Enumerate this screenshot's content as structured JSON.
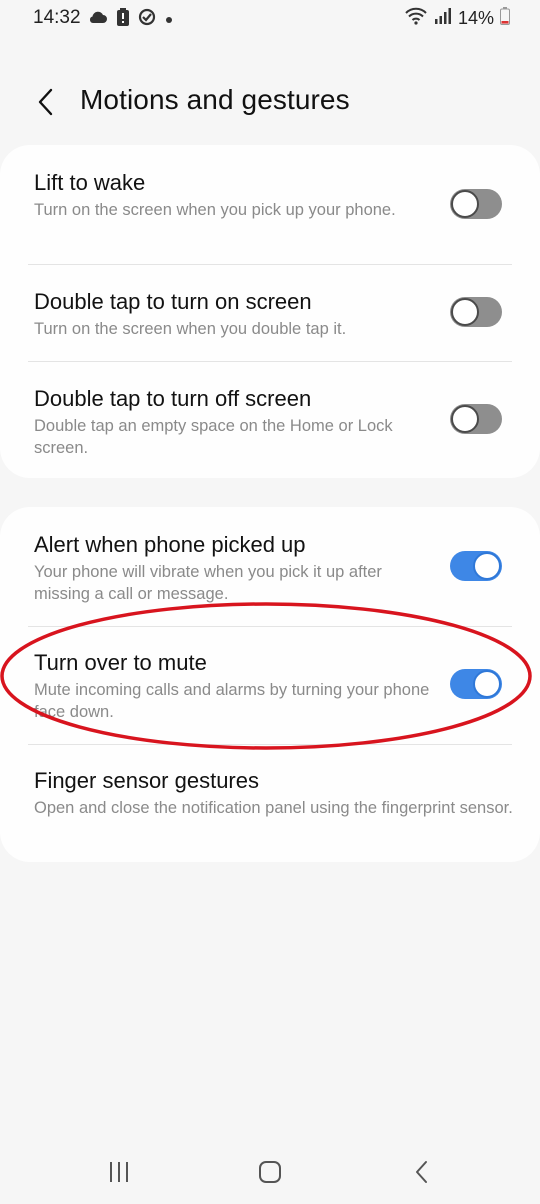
{
  "status_bar": {
    "time": "14:32",
    "battery": "14%"
  },
  "header": {
    "title": "Motions and gestures"
  },
  "group1": [
    {
      "title": "Lift to wake",
      "subtitle": "Turn on the screen when you pick up your phone.",
      "toggle": "off"
    },
    {
      "title": "Double tap to turn on screen",
      "subtitle": "Turn on the screen when you double tap it.",
      "toggle": "off"
    },
    {
      "title": "Double tap to turn off screen",
      "subtitle": "Double tap an empty space on the Home or Lock screen.",
      "toggle": "off"
    }
  ],
  "group2": [
    {
      "title": "Alert when phone picked up",
      "subtitle": "Your phone will vibrate when you pick it up after missing a call or message.",
      "toggle": "on"
    },
    {
      "title": "Turn over to mute",
      "subtitle": "Mute incoming calls and alarms by turning your phone face down.",
      "toggle": "on"
    },
    {
      "title": "Finger sensor gestures",
      "subtitle": "Open and close the notification panel using the fingerprint sensor."
    }
  ],
  "colors": {
    "accent": "#3e87e6",
    "annotation": "#d8141e",
    "toggle_off": "#8e8e8e"
  },
  "icons": [
    "cloud-icon",
    "battery-alert-icon",
    "sync-icon",
    "dot-icon",
    "wifi-icon",
    "signal-icon",
    "battery-icon",
    "back-arrow-icon",
    "recents-icon",
    "home-icon",
    "nav-back-icon"
  ]
}
